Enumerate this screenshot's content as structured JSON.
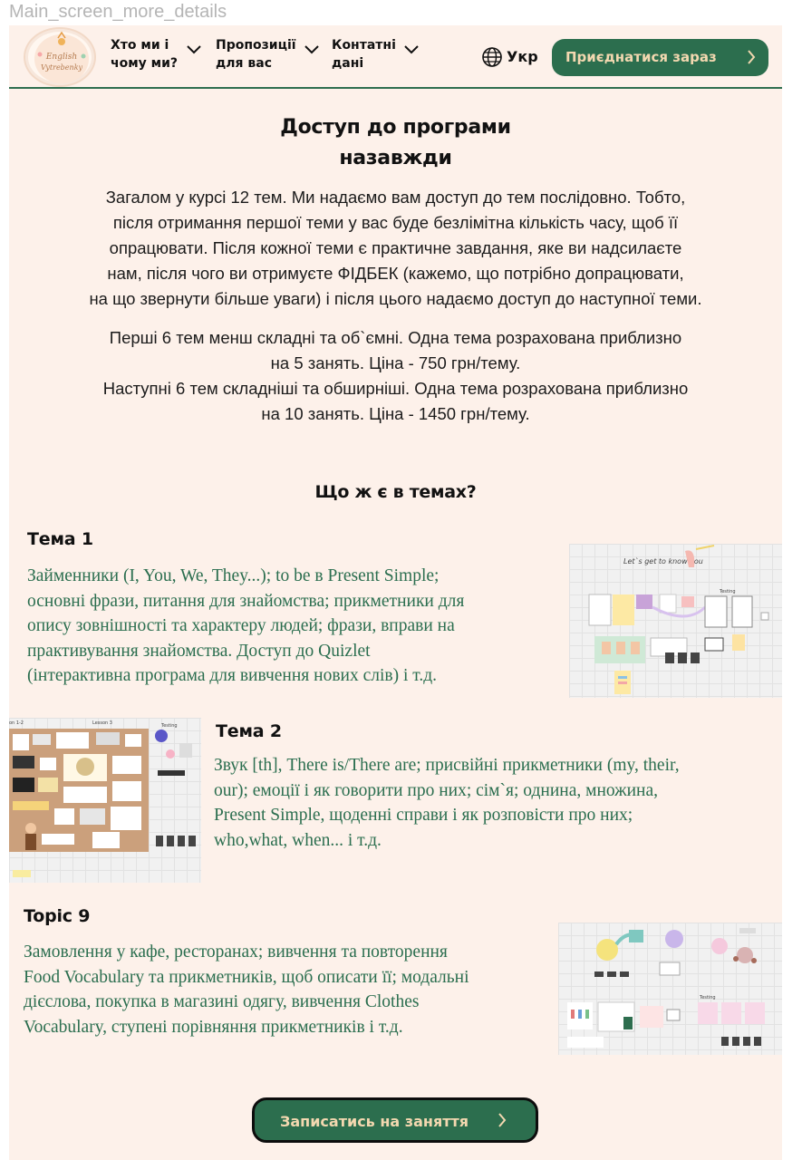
{
  "frame_label": "Main_screen_more_details",
  "header": {
    "logo_text": [
      "English",
      "Vytrebenky"
    ],
    "nav": [
      {
        "label": "Хто ми і\nчому ми?",
        "icon": "chevron-down-icon"
      },
      {
        "label": "Пропозиції\nдля вас",
        "icon": "chevron-down-icon"
      },
      {
        "label": "Контатні\nдані",
        "icon": "chevron-down-icon"
      }
    ],
    "language": {
      "label": "Укр",
      "icon": "globe-icon"
    },
    "join_button": {
      "label": "Приєднатися зараз",
      "icon": "chevron-right-icon"
    }
  },
  "intro": {
    "title": "Доступ до програми\nназавжди",
    "paragraph1": "Загалом у  курсі 12 тем. Ми надаємо вам доступ до тем послідовно. Тобто,\nпісля отримання першої теми у вас буде безлімітна кількість часу, щоб її\nопрацювати. Після кожної теми є практичне завдання, яке ви надсилаєте\nнам, після чого ви отримуєте ФІДБЕК (кажемо, що потрібно допрацювати,\nна що звернути більше уваги) і після цього надаємо доступ до наступної теми.",
    "paragraph2": "Перші 6 тем менш складні та об`ємні. Одна тема розрахована приблизно\nна 5 занять. Ціна - 750 грн/тему.\nНаступні 6 тем складніші та обширніші. Одна тема розрахована приблизно\nна 10 занять. Ціна - 1450 грн/тему."
  },
  "topics_section": {
    "title": "Що ж є в темах?",
    "topics": [
      {
        "title": "Тема 1",
        "text": "Займенники (I, You, We, They...); to be в Present Simple;\nосновні фрази, питання для знайомства; прикметники для\nопису зовнішності та характеру людей; фрази, вправи на\nпрактивування знайомства. Доступ до Quizlet\n(інтерактивна програма для вивчення нових слів) і т.д.",
        "thumbnail": {
          "title": "Let`s get to know you",
          "caption": "Testing"
        }
      },
      {
        "title": "Тема 2",
        "text": "Звук [th], There is/There are; присвійні прикметники (my, their,\nour); емоції і як говорити про них; сім`я; однина, множина,\nPresent Simple, щоденні справи і як розповісти про них;\nwho,what, when... і т.д.",
        "thumbnail": {
          "labels": [
            "on 1-2",
            "Lesson 3",
            "Testing"
          ]
        }
      },
      {
        "title": "Topic 9",
        "text": "Замовлення у кафе, ресторанах; вивчення та повторення\nFood Vocabulary та прикметників, щоб описати її; модальні\nдієслова, покупка в магазині одягу, вивчення Clothes\nVocabulary, ступені порівняння прикметників і т.д.",
        "thumbnail": {
          "caption": "Testing"
        }
      }
    ]
  },
  "cta_button": {
    "label": "Записатись на заняття",
    "icon": "chevron-right-icon"
  },
  "colors": {
    "background": "#fdf1ea",
    "accent_green": "#2c6e4e",
    "button_text": "#f3d8b0",
    "topic_text": "#2b6e4f"
  }
}
